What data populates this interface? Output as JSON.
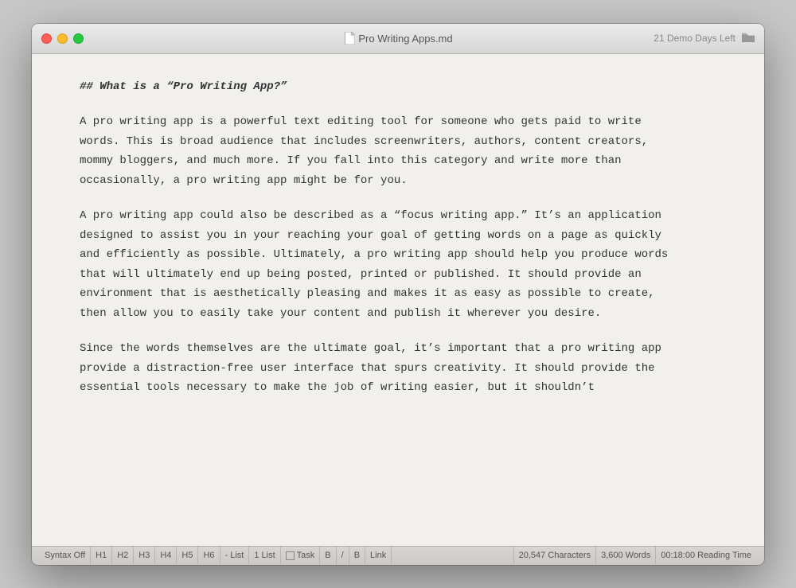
{
  "window": {
    "title": "Pro Writing Apps.md",
    "demo_days": "21 Demo Days Left"
  },
  "content": {
    "heading": "## What is a “Pro Writing App?”",
    "paragraphs": [
      "A pro writing app is a powerful text editing tool for someone who gets paid to write words. This is broad audience that includes screenwriters, authors, content creators, mommy bloggers, and much more. If you fall into this category and write more than occasionally, a pro writing app might be for you.",
      "A pro writing app could also be described as a “focus writing app.” It’s an application designed to assist you in your reaching your goal of getting words on a page as quickly and efficiently as possible. Ultimately, a pro writing app should help you produce words that will ultimately end up being posted, printed or published. It should provide an environment that is aesthetically pleasing and makes it as easy as possible to create, then allow you to easily take your content and publish it wherever you desire.",
      "Since the words themselves are the ultimate goal, it’s important that a pro writing app provide a distraction-free user interface that spurs creativity. It should provide the essential tools necessary to make the job of writing easier, but it shouldn’t"
    ]
  },
  "statusbar": {
    "syntax_off": "Syntax Off",
    "h1": "H1",
    "h2": "H2",
    "h3": "H3",
    "h4": "H4",
    "h5": "H5",
    "h6": "H6",
    "list_dash": "- List",
    "list_num": "1 List",
    "task": "Task",
    "bold": "B",
    "italic": "/",
    "bold_alt": "B",
    "link": "Link",
    "characters": "20,547 Characters",
    "words": "3,600 Words",
    "reading_time": "00:18:00 Reading Time"
  }
}
